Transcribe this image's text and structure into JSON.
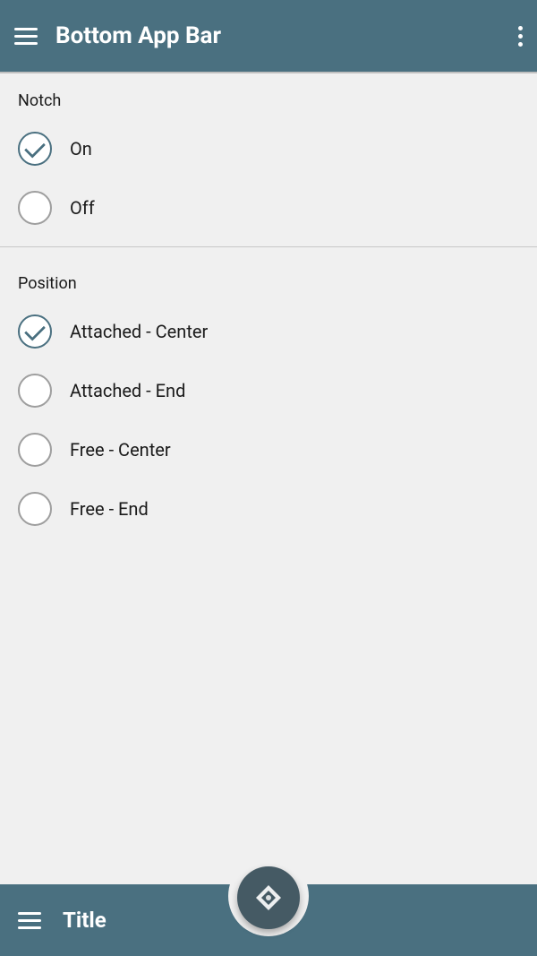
{
  "header": {
    "title": "Bottom App Bar",
    "hamburger_label": "menu",
    "more_label": "more options"
  },
  "notch_section": {
    "label": "Notch",
    "options": [
      {
        "id": "notch-on",
        "label": "On",
        "checked": true
      },
      {
        "id": "notch-off",
        "label": "Off",
        "checked": false
      }
    ]
  },
  "position_section": {
    "label": "Position",
    "options": [
      {
        "id": "pos-attached-center",
        "label": "Attached - Center",
        "checked": true
      },
      {
        "id": "pos-attached-end",
        "label": "Attached - End",
        "checked": false
      },
      {
        "id": "pos-free-center",
        "label": "Free - Center",
        "checked": false
      },
      {
        "id": "pos-free-end",
        "label": "Free - End",
        "checked": false
      }
    ]
  },
  "bottom_bar": {
    "title": "Title"
  }
}
